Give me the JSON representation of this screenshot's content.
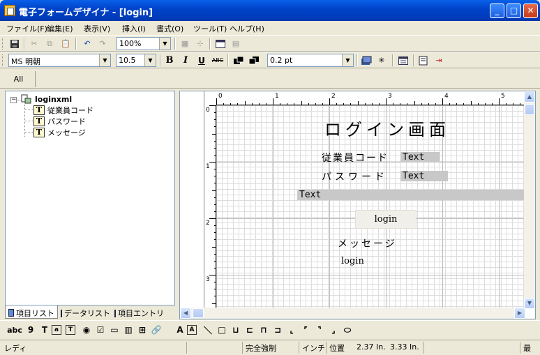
{
  "window": {
    "title": "電子フォームデザイナ - [login]",
    "minimize": "_",
    "maximize": "□",
    "close": "✕"
  },
  "menu": [
    "ファイル(F)",
    "編集(E)",
    "表示(V)",
    "挿入(I)",
    "書式(O)",
    "ツール(T)",
    "ヘルプ(H)"
  ],
  "toolbar1": {
    "zoom": "100%",
    "icons": [
      "save-icon",
      "cut-icon",
      "copy-icon",
      "paste-icon",
      "undo-icon",
      "redo-icon",
      "grid-icon",
      "snap-icon",
      "window-icon",
      "page-icon"
    ]
  },
  "toolbar2": {
    "font": "MS 明朝",
    "size": "10.5",
    "bold": "B",
    "italic": "I",
    "underline": "U",
    "strike": "ABC",
    "line_width": "0.2 pt"
  },
  "tabs": {
    "all": "All"
  },
  "tree": {
    "root": "loginxml",
    "expander": "−",
    "children": [
      "従業員コード",
      "パスワード",
      "メッセージ"
    ],
    "icon_letter": "T"
  },
  "left_tabs": [
    "項目リスト",
    "データリスト",
    "項目エントリ"
  ],
  "ruler": {
    "h_marks": [
      "0",
      "1",
      "2",
      "3",
      "4",
      "5"
    ],
    "v_marks": [
      "0",
      "1",
      "2",
      "3"
    ]
  },
  "form": {
    "title": "ログイン画面",
    "employee_label": "従業員コード",
    "employee_field": "Text",
    "password_label": "パスワード",
    "password_field": "Text",
    "wide_field": "Text",
    "login_button": "login",
    "message_label": "メッセージ",
    "message_value": "login"
  },
  "palette": [
    "abc",
    "9",
    "T",
    "a",
    "T",
    "◉",
    "☑",
    "▭",
    "▥",
    "⊞",
    "🔗",
    "A",
    "A",
    "＼",
    "□",
    "⊔",
    "⊏",
    "⊓",
    "⊐",
    "⌞",
    "⌜",
    "⌝",
    "⌟",
    "⬭"
  ],
  "status": {
    "ready": "レディ",
    "mode": "完全強制",
    "unit": "インチ",
    "pos_label": "位置",
    "x": "2.37 In.",
    "y": "3.33 In.",
    "end": "最"
  },
  "colors": {
    "titlebar": "#0A5FE8",
    "field_bg": "#C8C8C8",
    "window_bg": "#ECE9D8"
  }
}
